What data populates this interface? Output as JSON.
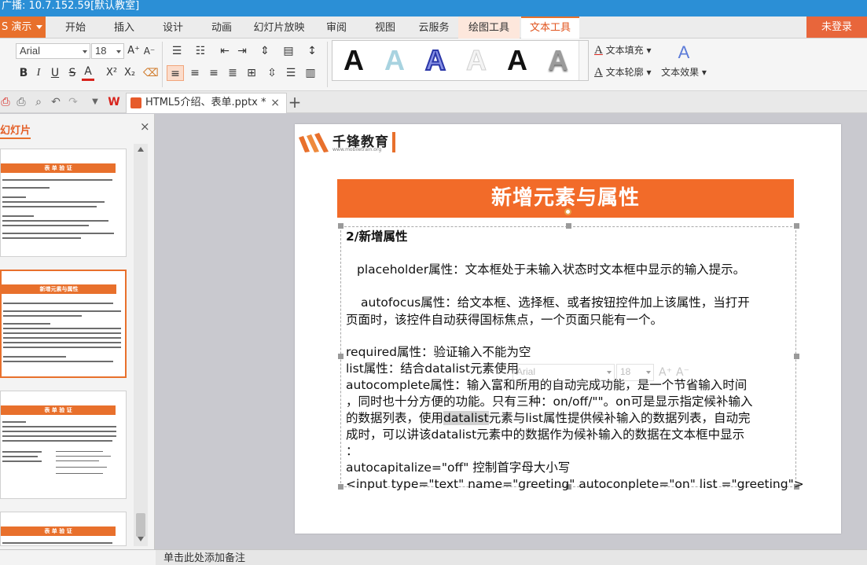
{
  "titlebar": {
    "text": "广播: 10.7.152.59[默认教室]"
  },
  "app_button": {
    "label": "S 演示"
  },
  "tabs": [
    {
      "label": "开始"
    },
    {
      "label": "插入"
    },
    {
      "label": "设计"
    },
    {
      "label": "动画"
    },
    {
      "label": "幻灯片放映"
    },
    {
      "label": "审阅"
    },
    {
      "label": "视图"
    },
    {
      "label": "云服务"
    },
    {
      "label": "绘图工具"
    },
    {
      "label": "文本工具"
    }
  ],
  "login_button": {
    "label": "未登录"
  },
  "ribbon": {
    "font_family": "Arial",
    "font_size": "18",
    "grow_font": "A⁺",
    "shrink_font": "A⁻",
    "bold": "B",
    "italic": "I",
    "underline": "U",
    "strike": "S",
    "font_color": "A",
    "superscript": "X²",
    "subscript": "X₂",
    "text_fill": "文本填充",
    "text_outline": "文本轮廓",
    "text_effect": "文本效果",
    "style_glyph": "A",
    "gallery_styles": [
      {
        "color": "#111111"
      },
      {
        "color": "#a8d3e0"
      },
      {
        "color": "#4656c9"
      },
      {
        "color": "#f4f4f4"
      },
      {
        "color": "#111111"
      },
      {
        "color": "#7a7a7a"
      }
    ]
  },
  "document_tab": {
    "title": "HTML5介绍、表单.pptx *",
    "close": "×",
    "app_mark": "W"
  },
  "slide_panel": {
    "header": "幻灯片",
    "close": "×",
    "add": "+",
    "thumbnails": [
      {
        "title": "表 单 验 证"
      },
      {
        "title": "新增元素与属性"
      },
      {
        "title": "表 单 验 证"
      },
      {
        "title": "表 单 验 证"
      }
    ]
  },
  "slide": {
    "logo_name": "千锋教育",
    "logo_url": "www.mobiletrain.org",
    "title": "新增元素与属性",
    "lines": [
      "2/新增属性",
      "placeholder属性：文本框处于未输入状态时文本框中显示的输入提示。",
      "autofocus属性：给文本框、选择框、或者按钮控件加上该属性，当打开",
      "页面时，该控件自动获得国标焦点，一个页面只能有一个。",
      "required属性：验证输入不能为空",
      "list属性：结合datalist元素使用",
      "autocomplete属性：输入富和所用的自动完成功能，是一个节省输入时间",
      "，同时也十分方便的功能。只有三种：on/off/\"\"。on可是显示指定候补输入",
      "的数据列表，使用",
      "datalist",
      "元素与list属性提供候补输入的数据列表，自动完",
      "成时，可以讲该datalist元素中的数据作为候补输入的数据在文本框中显示",
      "：",
      "autocapitalize=\"off\" 控制首字母大小写",
      "<input type=\"text\" name=\"greeting\" autoconplete=\"on\"  list =\"greeting\">"
    ],
    "mini_toolbar": {
      "font": "Arial",
      "size": "18"
    }
  },
  "notes": {
    "placeholder": "单击此处添加备注"
  }
}
